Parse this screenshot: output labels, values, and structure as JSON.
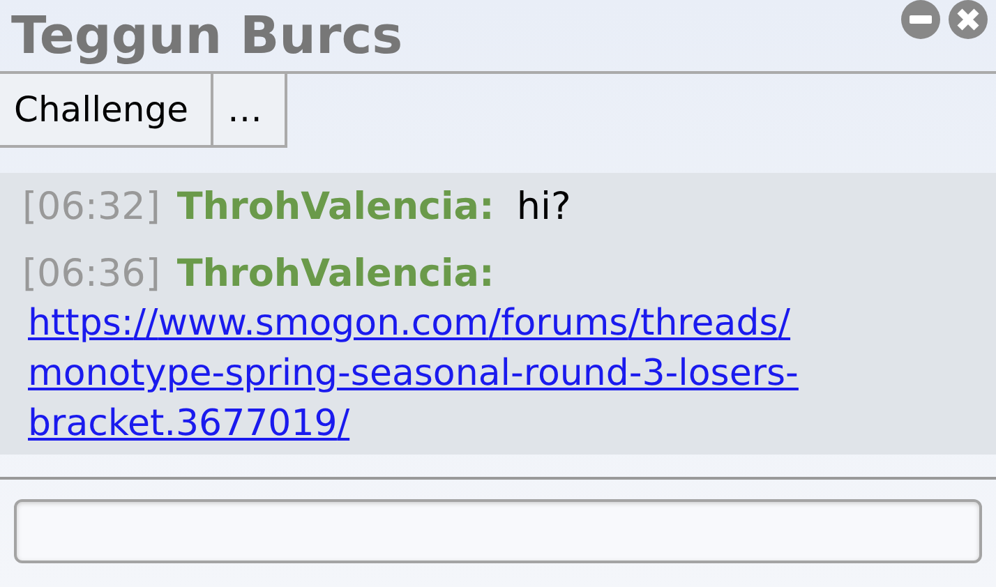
{
  "window": {
    "title": "Teggun Burcs"
  },
  "buttons": [
    "Challenge",
    "…"
  ],
  "messages": [
    {
      "kind": "text",
      "time": "[06:32]",
      "user": "ThrohValencia:",
      "text": "hi?"
    },
    {
      "kind": "link",
      "time": "[06:36]",
      "user": "ThrohValencia:",
      "text": "https://www.smogon.com/forums/threads/monotype-spring-seasonal-round-3-losers-bracket.3677019/"
    }
  ]
}
